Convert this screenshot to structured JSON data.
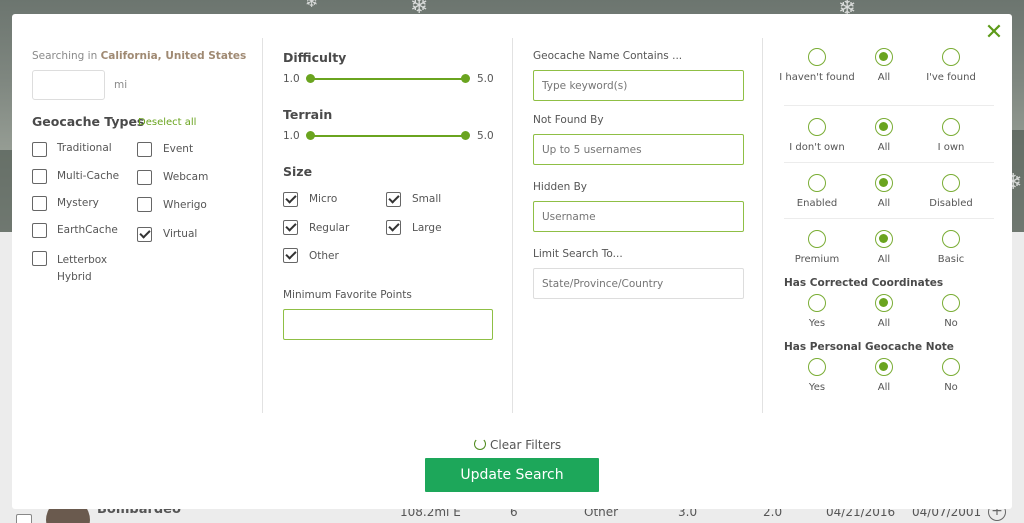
{
  "location": {
    "prefix": "Searching in",
    "place": "California, United States",
    "radius_value": "",
    "unit": "mi"
  },
  "types": {
    "heading": "Geocache Types",
    "deselect_all": "Deselect all",
    "items": [
      {
        "label": "Traditional",
        "checked": false
      },
      {
        "label": "Multi-Cache",
        "checked": false
      },
      {
        "label": "Mystery",
        "checked": false
      },
      {
        "label": "EarthCache",
        "checked": false
      },
      {
        "label": "Letterbox Hybrid",
        "checked": false
      },
      {
        "label": "Event",
        "checked": false
      },
      {
        "label": "Webcam",
        "checked": false
      },
      {
        "label": "Wherigo",
        "checked": false
      },
      {
        "label": "Virtual",
        "checked": true
      }
    ]
  },
  "difficulty": {
    "label": "Difficulty",
    "min": "1.0",
    "max": "5.0"
  },
  "terrain": {
    "label": "Terrain",
    "min": "1.0",
    "max": "5.0"
  },
  "size": {
    "heading": "Size",
    "items": [
      {
        "label": "Micro",
        "checked": true
      },
      {
        "label": "Small",
        "checked": true
      },
      {
        "label": "Regular",
        "checked": true
      },
      {
        "label": "Large",
        "checked": true
      },
      {
        "label": "Other",
        "checked": true
      }
    ]
  },
  "favorites": {
    "label": "Minimum Favorite Points",
    "value": ""
  },
  "text_filters": {
    "name_label": "Geocache Name Contains ...",
    "name_placeholder": "Type keyword(s)",
    "notfound_label": "Not Found By",
    "notfound_placeholder": "Up to 5 usernames",
    "hidden_label": "Hidden By",
    "hidden_placeholder": "Username",
    "limit_label": "Limit Search To...",
    "limit_placeholder": "State/Province/Country"
  },
  "radio_groups": [
    {
      "heading": "",
      "options": [
        "I haven't found",
        "All",
        "I've found"
      ],
      "selected": 1
    },
    {
      "heading": "",
      "options": [
        "I don't own",
        "All",
        "I own"
      ],
      "selected": 1
    },
    {
      "heading": "",
      "options": [
        "Enabled",
        "All",
        "Disabled"
      ],
      "selected": 1
    },
    {
      "heading": "",
      "options": [
        "Premium",
        "All",
        "Basic"
      ],
      "selected": 1
    },
    {
      "heading": "Has Corrected Coordinates",
      "options": [
        "Yes",
        "All",
        "No"
      ],
      "selected": 1
    },
    {
      "heading": "Has Personal Geocache Note",
      "options": [
        "Yes",
        "All",
        "No"
      ],
      "selected": 1
    }
  ],
  "actions": {
    "clear": "Clear Filters",
    "update": "Update Search"
  },
  "background_row": {
    "name": "Bombardeo",
    "distance": "108.2mi E",
    "favorites": "6",
    "size": "Other",
    "difficulty": "3.0",
    "terrain": "2.0",
    "last_found": "04/21/2016",
    "placed": "04/07/2001"
  },
  "colors": {
    "accent": "#6aa41f",
    "button": "#1da75a",
    "close": "#5c9a18"
  }
}
